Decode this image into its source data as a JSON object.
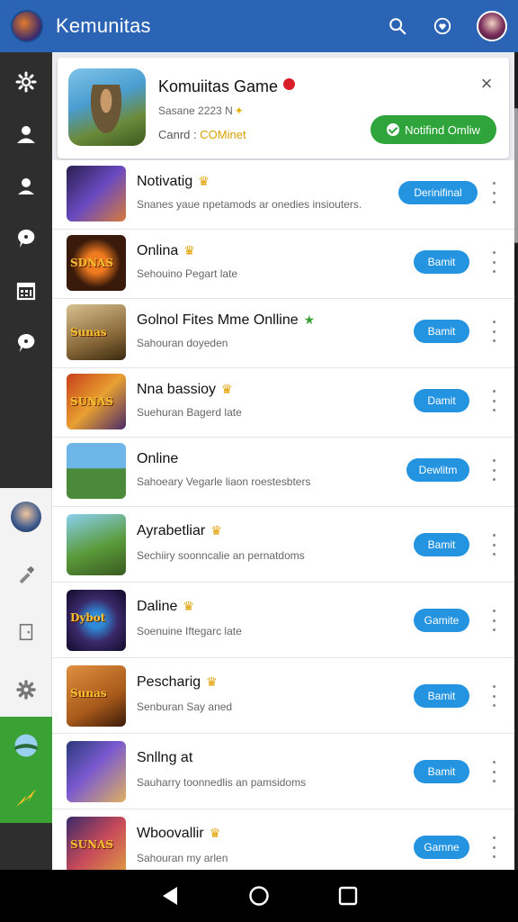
{
  "header": {
    "title": "Kemunitas",
    "logo_icon": "game-logo-icon",
    "search_icon": "search-icon",
    "notification_icon": "heart-icon",
    "avatar_icon": "user-avatar"
  },
  "sidebar": {
    "top_items": [
      "settings-icon",
      "user-icon",
      "user-icon",
      "chat-icon",
      "calendar-icon",
      "chat-icon"
    ],
    "light_items": [
      "avatar",
      "tool-icon",
      "door-icon",
      "gear-icon"
    ],
    "green_items": [
      "globe-icon",
      "star-icon"
    ]
  },
  "featured": {
    "title": "Komuiitas Game",
    "subtitle": "Sasane 2223 N",
    "meta_label": "Canrd :",
    "meta_value": "COMinet",
    "action_label": "Notifind Omliw",
    "close_label": "×"
  },
  "items": [
    {
      "title": "Notivatig",
      "badge": "crown-icon",
      "subtitle": "Snanes yaue npetamods ar onedies insiouters.",
      "button": "Derinifinal",
      "thumb_text": ""
    },
    {
      "title": "Onlina",
      "badge": "crown-icon",
      "subtitle": "Sehouino Pegart late",
      "button": "Bamit",
      "thumb_text": "SDNAS"
    },
    {
      "title": "Golnol Fites Mme Onlline",
      "badge": "star-icon",
      "subtitle": "Sahouran doyeden",
      "button": "Bamit",
      "thumb_text": "Sunas"
    },
    {
      "title": "Nna bassioy",
      "badge": "crown-icon",
      "subtitle": "Suehuran Bagerd late",
      "button": "Damit",
      "thumb_text": "SUNAS"
    },
    {
      "title": "Online",
      "badge": "",
      "subtitle": "Sahoeary Vegarle liaon roestesbters",
      "button": "Dewlitm",
      "thumb_text": ""
    },
    {
      "title": "Ayrabetliar",
      "badge": "crown-icon",
      "subtitle": "Sechiiry soonncalie an pernatdoms",
      "button": "Bamit",
      "thumb_text": ""
    },
    {
      "title": "Daline",
      "badge": "crown-icon",
      "subtitle": "Soenuine Iftegarc late",
      "button": "Gamite",
      "thumb_text": "Dybot"
    },
    {
      "title": "Pescharig",
      "badge": "crown-icon",
      "subtitle": "Senburan Say aned",
      "button": "Bamit",
      "thumb_text": "Sunas"
    },
    {
      "title": "Snllng at",
      "badge": "",
      "subtitle": "Sauharry toonnedlis an pamsidoms",
      "button": "Bamit",
      "thumb_text": ""
    },
    {
      "title": "Wboovallir",
      "badge": "crown-icon",
      "subtitle": "Sahouran my arlen",
      "button": "Gamne",
      "thumb_text": "SUNAS"
    }
  ],
  "navbar": {
    "back_icon": "back-icon",
    "home_icon": "home-icon",
    "recents_icon": "recents-icon"
  }
}
